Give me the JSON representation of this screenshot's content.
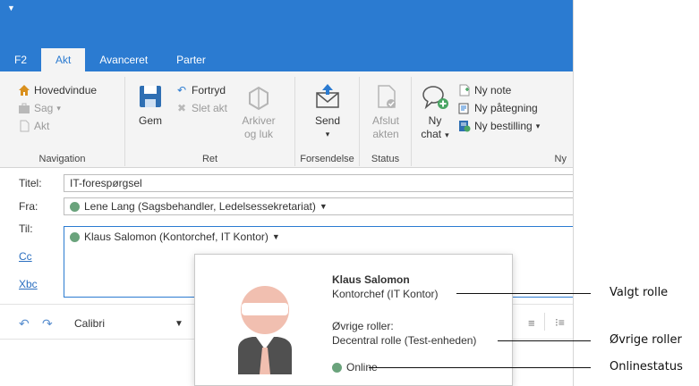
{
  "tabs": [
    "F2",
    "Akt",
    "Avanceret",
    "Parter"
  ],
  "ribbon": {
    "navigation": {
      "label": "Navigation",
      "items": [
        "Hovedvindue",
        "Sag",
        "Akt"
      ]
    },
    "ret": {
      "label": "Ret",
      "gem": "Gem",
      "fortryd": "Fortryd",
      "slet": "Slet akt",
      "arkiver1": "Arkiver",
      "arkiver2": "og luk"
    },
    "forsendelse": {
      "label": "Forsendelse",
      "send": "Send"
    },
    "status": {
      "label": "Status",
      "afslut1": "Afslut",
      "afslut2": "akten"
    },
    "ny": {
      "label": "Ny",
      "chat1": "Ny",
      "chat2": "chat",
      "note": "Ny note",
      "paategning": "Ny påtegning",
      "bestilling": "Ny bestilling"
    }
  },
  "fields": {
    "titel_label": "Titel:",
    "titel_value": "IT-forespørgsel",
    "fra_label": "Fra:",
    "fra_value": "Lene Lang (Sagsbehandler, Ledelsessekretariat)",
    "til_label": "Til:",
    "til_value": "Klaus Salomon (Kontorchef, IT Kontor)",
    "cc_label": "Cc",
    "xbc_label": "Xbc"
  },
  "editor": {
    "font": "Calibri"
  },
  "popup": {
    "name": "Klaus Salomon",
    "role": "Kontorchef (IT Kontor)",
    "other_label": "Øvrige roller:",
    "other_value": "Decentral rolle (Test-enheden)",
    "status": "Online"
  },
  "annotations": {
    "valgt": "Valgt rolle",
    "ovrige": "Øvrige roller",
    "online": "Onlinestatus"
  },
  "colors": {
    "accent": "#2b7bd1",
    "online": "#6aa37c"
  }
}
